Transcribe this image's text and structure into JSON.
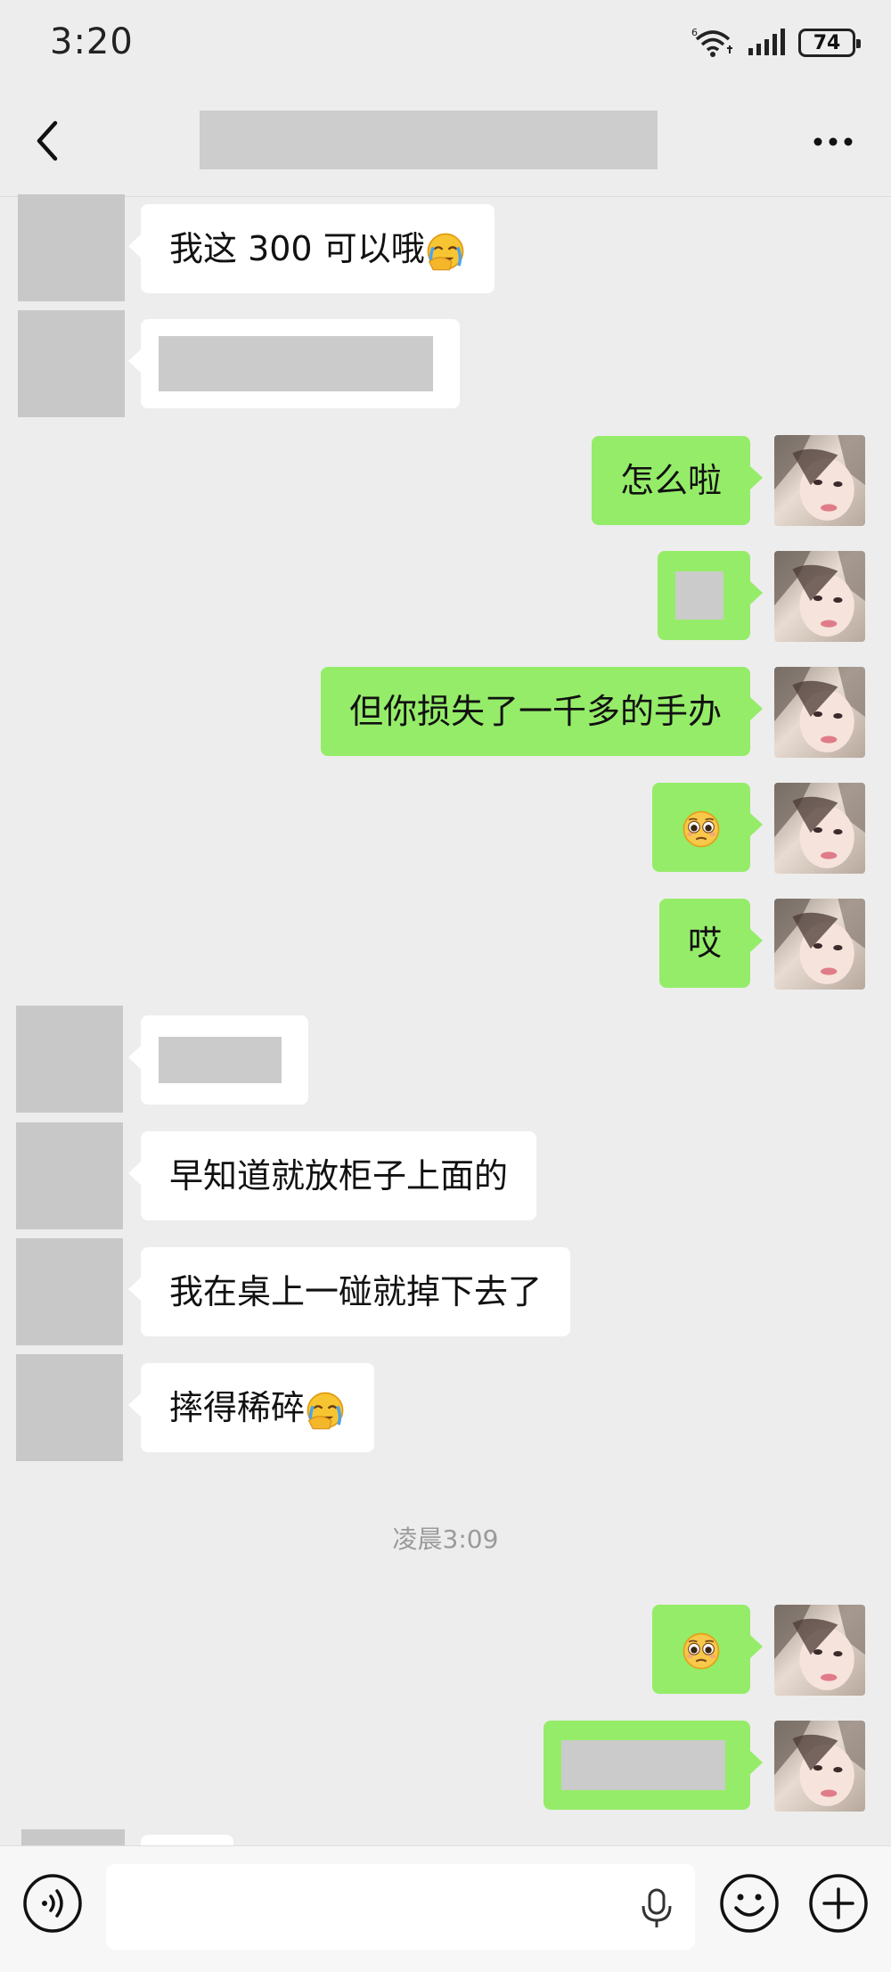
{
  "status_bar": {
    "time": "3:20",
    "network_badge": "6",
    "battery_level": "74",
    "icons": [
      "wifi-icon",
      "signal-icon",
      "battery-icon"
    ]
  },
  "header": {
    "title_redacted": true,
    "back_icon": "chevron-left-icon",
    "more_icon": "more-dots-icon"
  },
  "messages": {
    "m1": "我这 300 可以哦",
    "m3": "怎么啦",
    "m5": "但你损失了一千多的手办",
    "m7": "哎",
    "m9": "早知道就放柜子上面的",
    "m10": "我在桌上一碰就掉下去了",
    "m11": "摔得稀碎"
  },
  "emojis": {
    "laugh_cry": "facepalm-cry-emoji",
    "pleading": "pleading-face-emoji"
  },
  "timestamp": "凌晨3:09",
  "input_bar": {
    "voice_icon": "voice-icon",
    "mic_icon": "mic-icon",
    "emoji_icon": "smiley-icon",
    "plus_icon": "plus-icon"
  },
  "colors": {
    "sent_bubble": "#95ec69",
    "received_bubble": "#ffffff",
    "background": "#ededed",
    "redaction": "#cbcbcb"
  }
}
